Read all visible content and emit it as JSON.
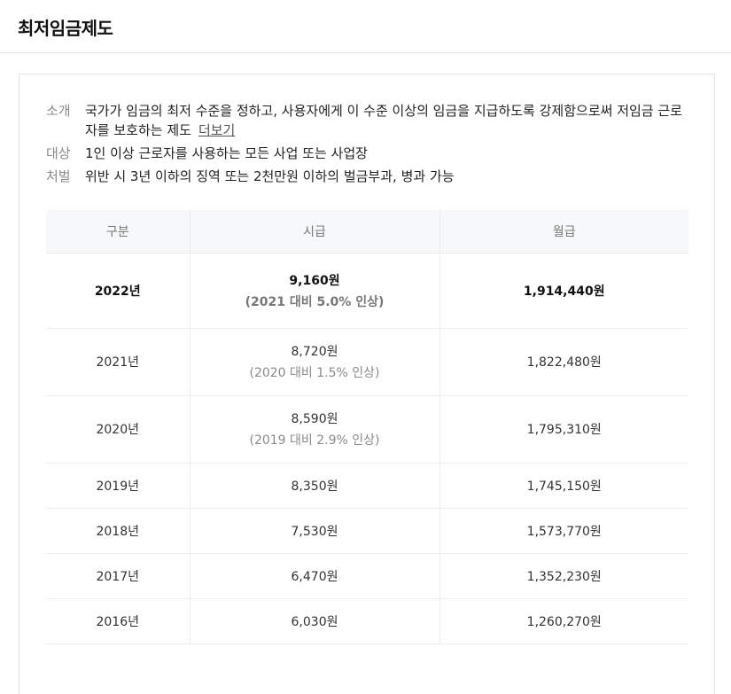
{
  "page": {
    "title": "최저임금제도"
  },
  "info": {
    "intro_label": "소개",
    "intro_text": "국가가 임금의 최저 수준을 정하고, 사용자에게 이 수준 이상의 임금을 지급하도록 강제함으로써 저임금 근로자를 보호하는 제도",
    "more_link": "더보기",
    "target_label": "대상",
    "target_text": "1인 이상 근로자를 사용하는 모든 사업 또는 사업장",
    "penalty_label": "처벌",
    "penalty_text": "위반 시 3년 이하의 징역 또는 2천만원 이하의 벌금부과, 병과 가능"
  },
  "table": {
    "headers": [
      "구분",
      "시급",
      "월급"
    ],
    "rows": [
      {
        "year": "2022년",
        "hourly": "9,160원",
        "note": "(2021 대비 5.0% 인상)",
        "monthly": "1,914,440원"
      },
      {
        "year": "2021년",
        "hourly": "8,720원",
        "note": "(2020 대비 1.5% 인상)",
        "monthly": "1,822,480원"
      },
      {
        "year": "2020년",
        "hourly": "8,590원",
        "note": "(2019 대비 2.9% 인상)",
        "monthly": "1,795,310원"
      },
      {
        "year": "2019년",
        "hourly": "8,350원",
        "monthly": "1,745,150원"
      },
      {
        "year": "2018년",
        "hourly": "7,530원",
        "monthly": "1,573,770원"
      },
      {
        "year": "2017년",
        "hourly": "6,470원",
        "monthly": "1,352,230원"
      },
      {
        "year": "2016년",
        "hourly": "6,030원",
        "monthly": "1,260,270원"
      }
    ]
  }
}
